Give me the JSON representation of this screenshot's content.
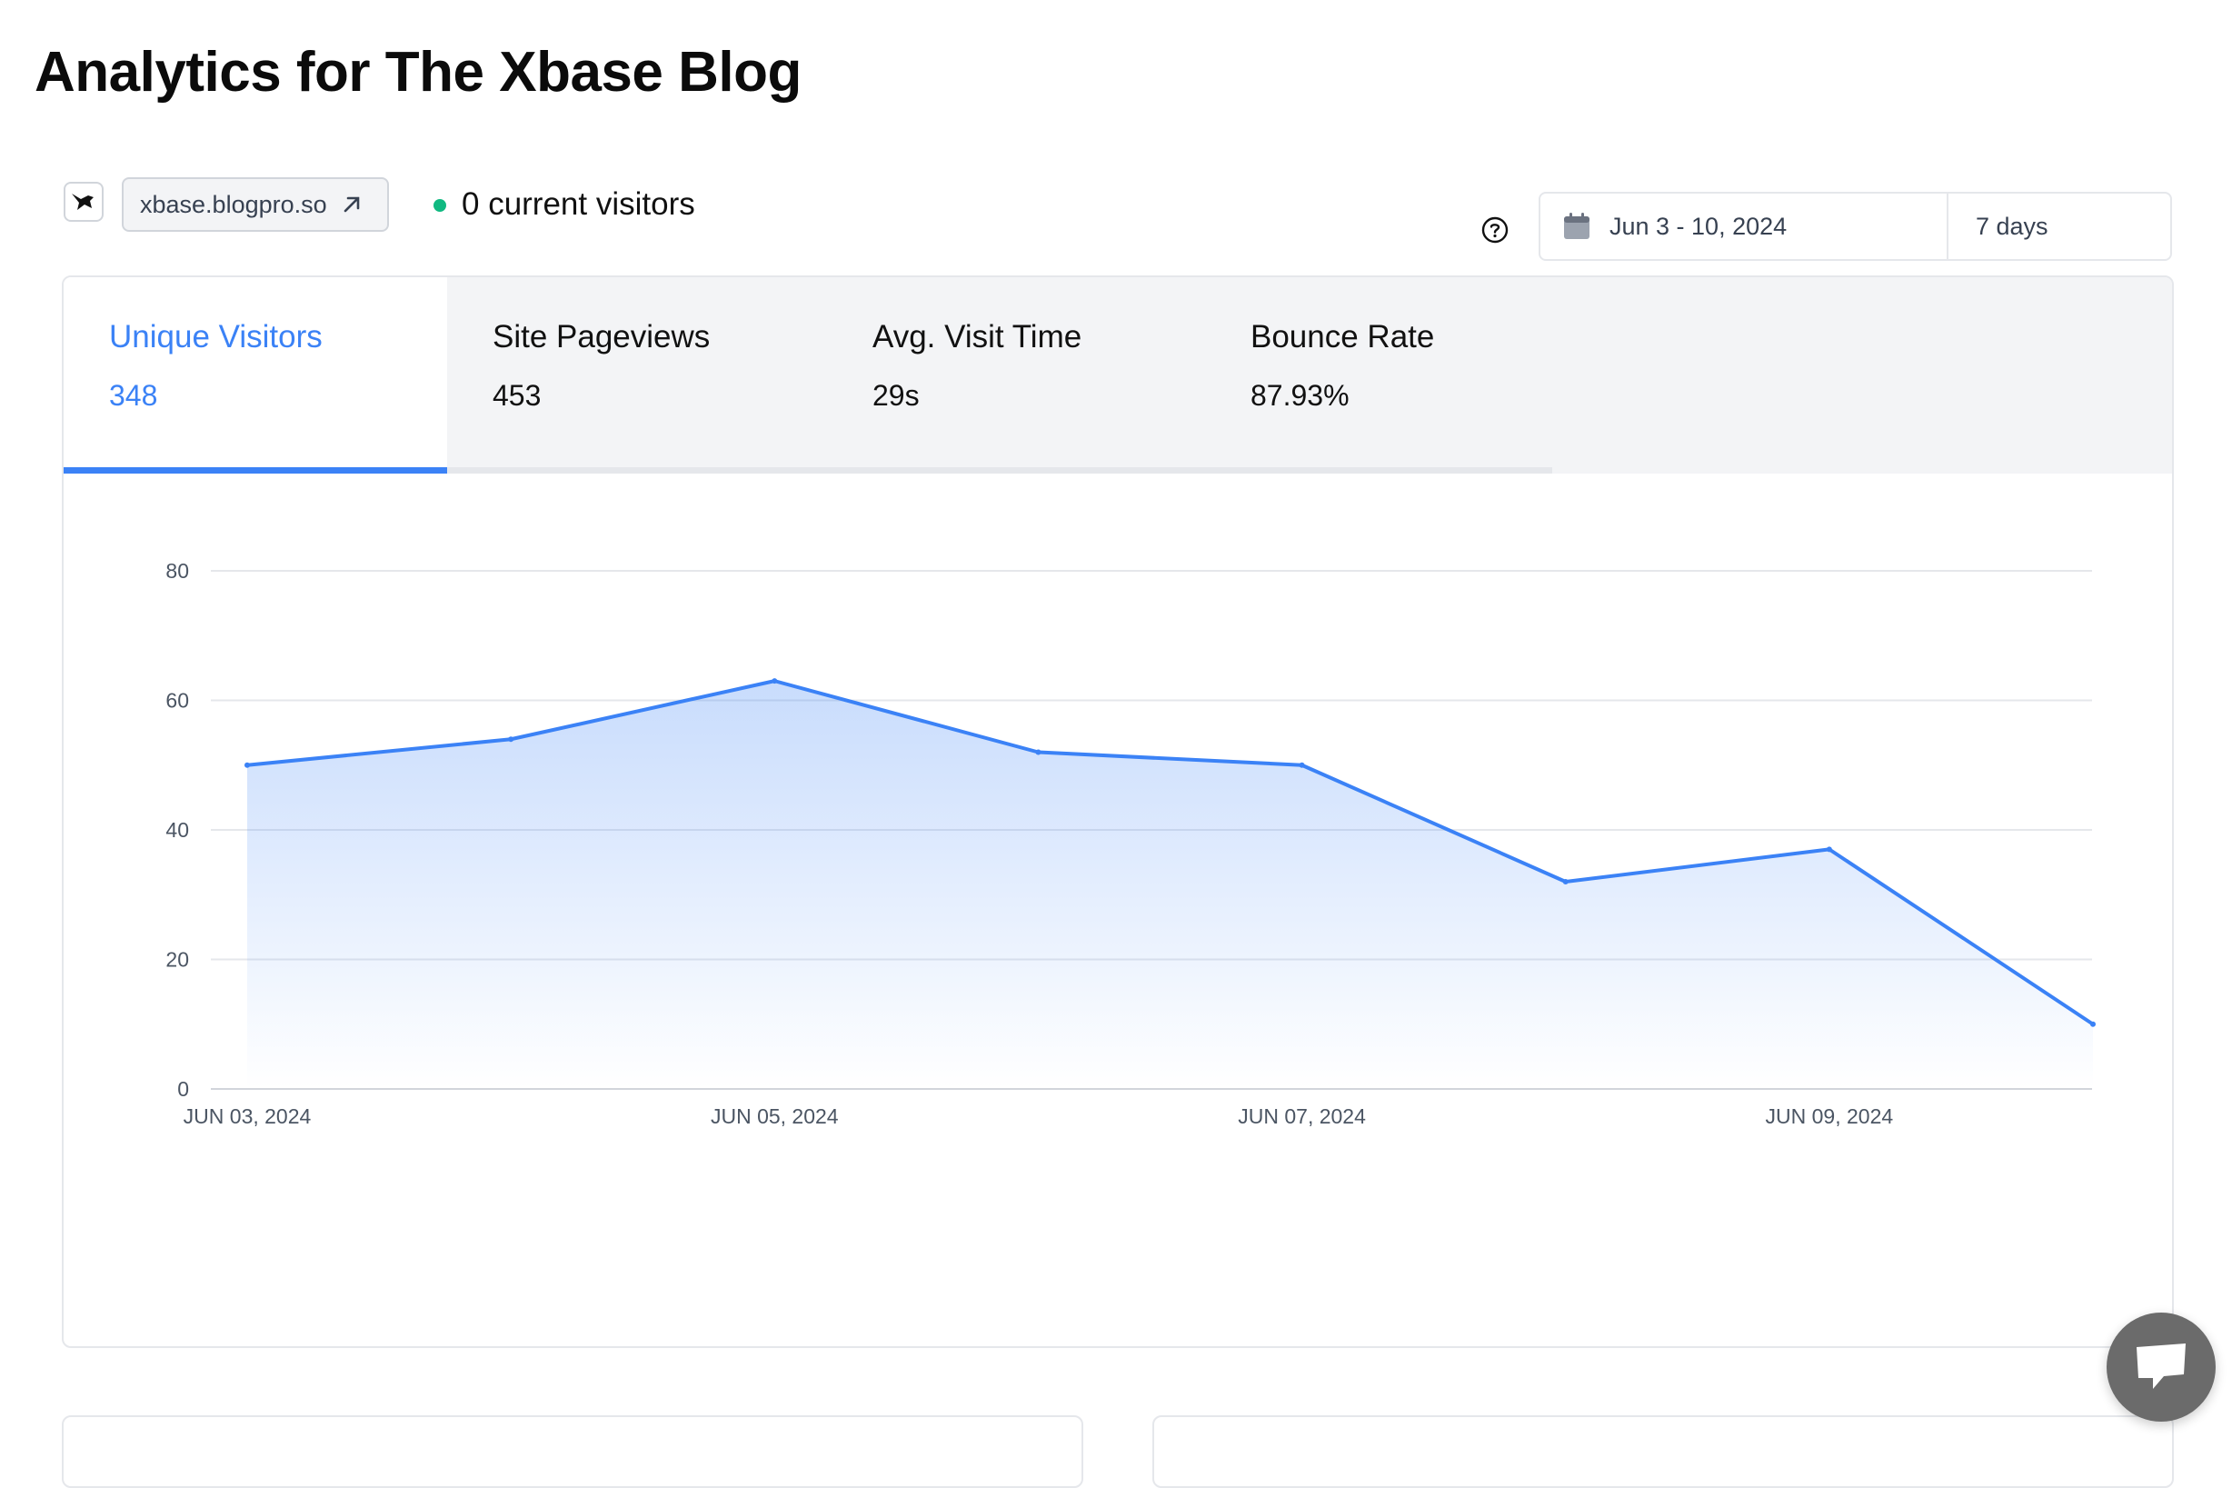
{
  "page": {
    "title": "Analytics for The Xbase Blog"
  },
  "site": {
    "domain": "xbase.blogpro.so",
    "logo_icon": "bird-logo-icon",
    "external_icon": "arrow-up-right-icon"
  },
  "live": {
    "text": "0 current visitors",
    "dot_color": "#10b981"
  },
  "date_filter": {
    "range": "Jun 3 - 10, 2024",
    "preset": "7 days",
    "calendar_icon": "calendar-icon",
    "help_icon": "question-circle-icon"
  },
  "metrics": {
    "tabs": [
      {
        "label": "Unique Visitors",
        "value": "348",
        "active": true
      },
      {
        "label": "Site Pageviews",
        "value": "453",
        "active": false
      },
      {
        "label": "Avg. Visit Time",
        "value": "29s",
        "active": false
      },
      {
        "label": "Bounce Rate",
        "value": "87.93%",
        "active": false
      }
    ]
  },
  "colors": {
    "accent": "#3b82f6",
    "line": "#3b82f6",
    "grid": "#e5e7eb",
    "tab_bg": "#f3f4f6"
  },
  "chart_data": {
    "type": "area",
    "title": "",
    "xlabel": "",
    "ylabel": "",
    "x": [
      "2024-06-03",
      "2024-06-04",
      "2024-06-05",
      "2024-06-06",
      "2024-06-07",
      "2024-06-08",
      "2024-06-09",
      "2024-06-10"
    ],
    "series": [
      {
        "values": [
          50,
          54,
          63,
          52,
          50,
          32,
          37,
          10
        ]
      }
    ],
    "x_tick_labels": [
      "JUN 03, 2024",
      "JUN 05, 2024",
      "JUN 07, 2024",
      "JUN 09, 2024"
    ],
    "y_ticks": [
      0,
      20,
      40,
      60,
      80
    ],
    "ylim": [
      0,
      80
    ],
    "grid": true,
    "legend": "none"
  },
  "chat": {
    "icon": "chat-bubble-icon"
  }
}
